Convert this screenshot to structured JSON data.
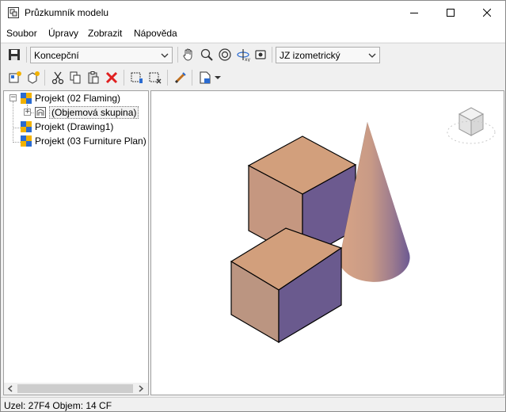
{
  "window": {
    "title": "Průzkumník modelu"
  },
  "menu": {
    "items": [
      "Soubor",
      "Úpravy",
      "Zobrazit",
      "Nápověda"
    ]
  },
  "toolbar": {
    "visual_style": "Koncepční",
    "view": "JZ izometrický",
    "icons_row1": [
      "save-icon",
      "pan-hand-icon",
      "zoom-icon",
      "zoom-extents-icon",
      "orbit-icon",
      "camera-icon"
    ],
    "icons_row2": [
      "new-node-icon",
      "new-object-icon",
      "cut-icon",
      "copy-icon",
      "paste-icon",
      "delete-icon",
      "select-icon",
      "deselect-icon",
      "edit-icon",
      "page-icon"
    ]
  },
  "tree": {
    "items": [
      {
        "label": "Projekt (02 Flaming)"
      },
      {
        "label": "(Objemová skupina)"
      },
      {
        "label": "Projekt (Drawing1)"
      },
      {
        "label": "Projekt (03 Furniture Plan)"
      }
    ]
  },
  "status": {
    "text": "Uzel: 27F4  Objem: 14 CF"
  },
  "colors": {
    "box_top": "#d19f7c",
    "box_left": "#b9917d",
    "box_right": "#6a5a8e",
    "accent_red": "#e02020"
  }
}
